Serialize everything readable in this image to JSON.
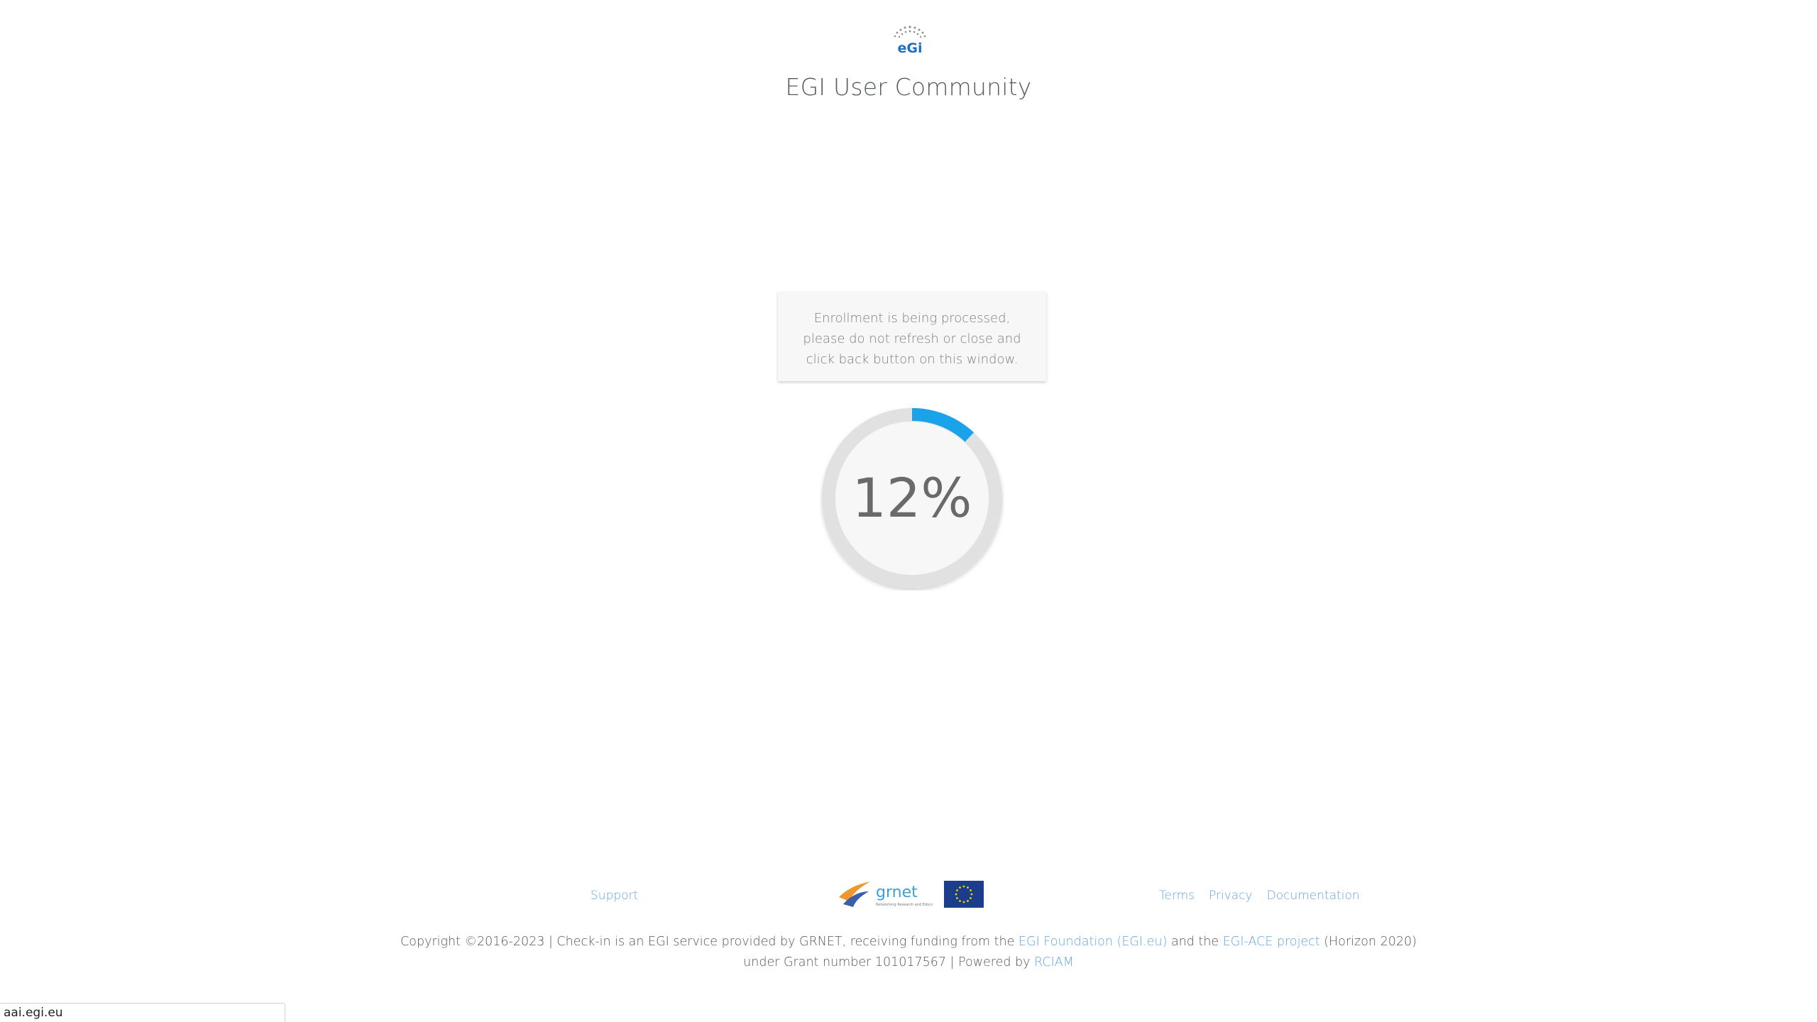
{
  "header": {
    "logo_icon": "egi-logo-icon",
    "title": "EGI User Community"
  },
  "notice": {
    "text": "Enrollment is being processed, please do not refresh or close and click back button on this window."
  },
  "progress": {
    "value": 12,
    "label": "12%",
    "accent_color": "#1aa3e8",
    "track_color": "#e1e1e1"
  },
  "footer": {
    "support_label": "Support",
    "partner_logos": [
      "grnet-logo",
      "eu-flag-icon"
    ],
    "links": [
      "Terms",
      "Privacy",
      "Documentation"
    ],
    "copyright": {
      "line1_part1": "Copyright ©2016-2023 | Check-in is an EGI service provided by GRNET, receiving funding from the ",
      "link1": "EGI Foundation (EGI.eu)",
      "line1_part2": " and the ",
      "link2": "EGI-ACE project",
      "line1_part3": " (Horizon 2020)",
      "line2_part1": "under Grant number 101017567 | Powered by ",
      "link3": "RCIAM"
    },
    "link_color": "#63a4e0"
  },
  "status_bar": {
    "url": "aai.egi.eu"
  }
}
